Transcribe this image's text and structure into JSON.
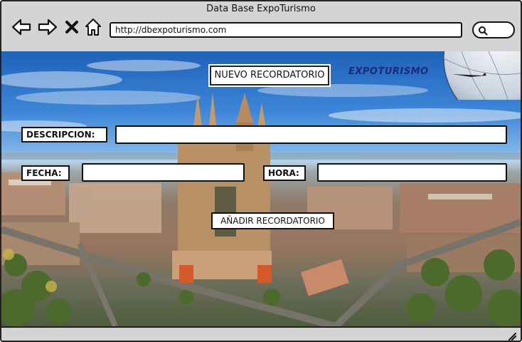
{
  "window": {
    "title": "Data Base ExpoTurismo"
  },
  "toolbar": {
    "back_icon": "arrow-left-icon",
    "forward_icon": "arrow-right-icon",
    "close_icon": "x-icon",
    "home_icon": "home-icon",
    "search_icon": "search-icon"
  },
  "address_bar": {
    "url": "http://dbexpoturismo.com"
  },
  "content": {
    "logo": "EXPOTURISMO",
    "heading": "NUEVO RECORDATORIO",
    "form": {
      "descripcion_label": "DESCRIPCION:",
      "descripcion_value": "",
      "fecha_label": "FECHA:",
      "fecha_value": "",
      "hora_label": "HORA:",
      "hora_value": "",
      "submit_label": "AÑADIR RECORDATORIO"
    }
  }
}
